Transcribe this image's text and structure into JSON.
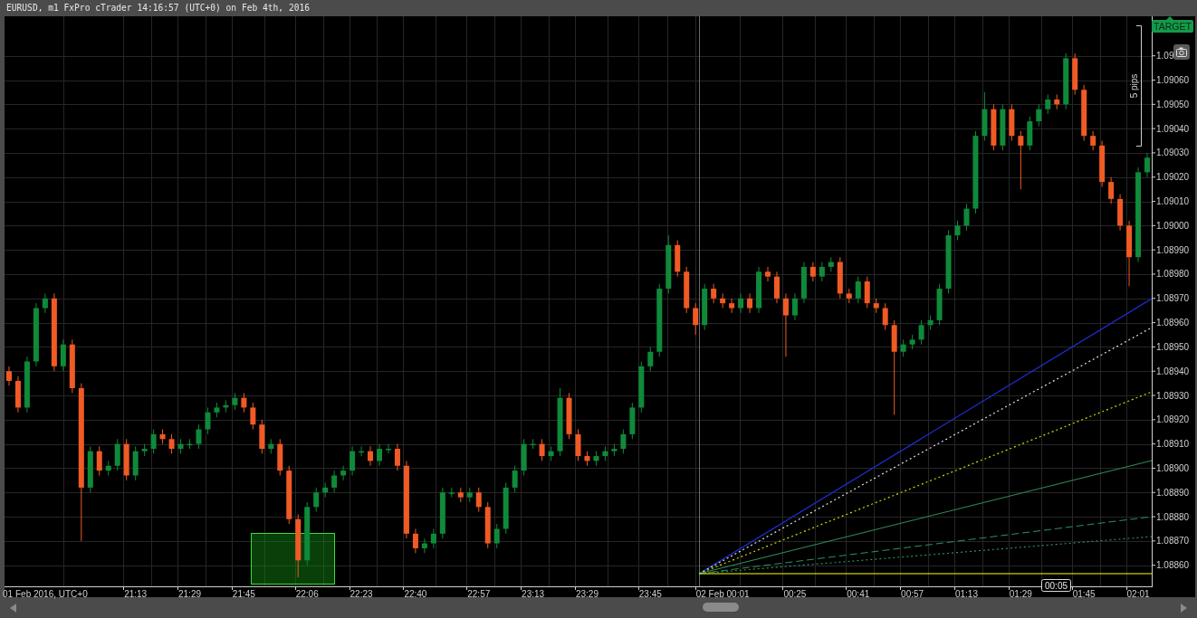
{
  "window": {
    "title": "EURUSD, m1 FxPro cTrader 14:16:57 (UTC+0) on Feb 4th, 2016"
  },
  "chart": {
    "target_label": "TARGET",
    "measure_label": "5 pips",
    "time_to_close": "00:05",
    "chart_data": {
      "type": "candlestick",
      "grid": true,
      "ylim": [
        1.088513,
        1.090863
      ],
      "categories": [
        null,
        null,
        null,
        null,
        "01 Feb 2016, UTC+0",
        null,
        null,
        null,
        null,
        null,
        null,
        null,
        null,
        null,
        "21:13",
        null,
        null,
        null,
        null,
        null,
        "21:29",
        null,
        null,
        null,
        null,
        null,
        "21:45",
        null,
        null,
        null,
        null,
        null,
        null,
        "22:06",
        null,
        null,
        null,
        null,
        null,
        "22:23",
        null,
        null,
        null,
        null,
        null,
        "22:40",
        null,
        null,
        null,
        null,
        null,
        null,
        "22:57",
        null,
        null,
        null,
        null,
        null,
        "23:13",
        null,
        null,
        null,
        null,
        null,
        "23:29",
        null,
        null,
        null,
        null,
        null,
        null,
        "23:45",
        null,
        null,
        null,
        null,
        null,
        null,
        null,
        "02 Feb 00:01",
        null,
        null,
        null,
        null,
        null,
        null,
        null,
        "00:25",
        null,
        null,
        null,
        null,
        null,
        null,
        "00:41",
        null,
        null,
        null,
        null,
        null,
        "00:57",
        null,
        null,
        null,
        null,
        null,
        "01:13",
        null,
        null,
        null,
        null,
        null,
        "01:29",
        null,
        null,
        null,
        null,
        null,
        null,
        "01:45",
        null,
        null,
        null,
        null,
        null,
        "02:01",
        null
      ],
      "yticks": [
        {
          "value": 1.0907,
          "label": "1.09"
        },
        {
          "value": 1.0906,
          "label": "1.09060"
        },
        {
          "value": 1.0905,
          "label": "1.09050"
        },
        {
          "value": 1.0904,
          "label": "1.09040"
        },
        {
          "value": 1.0903,
          "label": "1.09030"
        },
        {
          "value": 1.0902,
          "label": "1.09020"
        },
        {
          "value": 1.0901,
          "label": "1.09010"
        },
        {
          "value": 1.09,
          "label": "1.09000"
        },
        {
          "value": 1.0899,
          "label": "1.08990"
        },
        {
          "value": 1.0898,
          "label": "1.08980"
        },
        {
          "value": 1.0897,
          "label": "1.08970"
        },
        {
          "value": 1.0896,
          "label": "1.08960"
        },
        {
          "value": 1.0895,
          "label": "1.08950"
        },
        {
          "value": 1.0894,
          "label": "1.08940"
        },
        {
          "value": 1.0893,
          "label": "1.08930"
        },
        {
          "value": 1.0892,
          "label": "1.08920"
        },
        {
          "value": 1.0891,
          "label": "1.08910"
        },
        {
          "value": 1.089,
          "label": "1.08900"
        },
        {
          "value": 1.0889,
          "label": "1.08890"
        },
        {
          "value": 1.0888,
          "label": "1.08880"
        },
        {
          "value": 1.0887,
          "label": "1.08870"
        },
        {
          "value": 1.0886,
          "label": "1.08860"
        }
      ],
      "ohlc": [
        [
          1.0894,
          1.08942,
          1.08934,
          1.08936
        ],
        [
          1.08936,
          1.08938,
          1.08923,
          1.08925
        ],
        [
          1.08925,
          1.08946,
          1.08923,
          1.08944
        ],
        [
          1.08944,
          1.08968,
          1.08942,
          1.08966
        ],
        [
          1.08966,
          1.08972,
          1.08964,
          1.0897
        ],
        [
          1.0897,
          1.08972,
          1.0894,
          1.08942
        ],
        [
          1.08942,
          1.08953,
          1.0894,
          1.08951
        ],
        [
          1.08951,
          1.08953,
          1.08931,
          1.08933
        ],
        [
          1.08933,
          1.08935,
          1.0887,
          1.08892
        ],
        [
          1.08892,
          1.08909,
          1.0889,
          1.08907
        ],
        [
          1.08907,
          1.08909,
          1.08897,
          1.08899
        ],
        [
          1.08899,
          1.08903,
          1.08897,
          1.08901
        ],
        [
          1.08901,
          1.08912,
          1.08899,
          1.0891
        ],
        [
          1.0891,
          1.08912,
          1.08895,
          1.08897
        ],
        [
          1.08897,
          1.08909,
          1.08895,
          1.08907
        ],
        [
          1.08907,
          1.0891,
          1.08905,
          1.08908
        ],
        [
          1.08908,
          1.08916,
          1.08906,
          1.08914
        ],
        [
          1.08914,
          1.08916,
          1.0891,
          1.08912
        ],
        [
          1.08912,
          1.08914,
          1.08906,
          1.08908
        ],
        [
          1.08908,
          1.08912,
          1.08906,
          1.0891
        ],
        [
          1.0891,
          1.08912,
          1.08908,
          1.0891
        ],
        [
          1.0891,
          1.08918,
          1.08908,
          1.08916
        ],
        [
          1.08916,
          1.08925,
          1.08914,
          1.08923
        ],
        [
          1.08923,
          1.08927,
          1.08921,
          1.08925
        ],
        [
          1.08925,
          1.08928,
          1.08923,
          1.08926
        ],
        [
          1.08926,
          1.08931,
          1.08924,
          1.08929
        ],
        [
          1.08929,
          1.08931,
          1.08923,
          1.08925
        ],
        [
          1.08925,
          1.08927,
          1.08916,
          1.08918
        ],
        [
          1.08918,
          1.0892,
          1.08906,
          1.08908
        ],
        [
          1.08908,
          1.08912,
          1.08906,
          1.0891
        ],
        [
          1.0891,
          1.08912,
          1.08897,
          1.08899
        ],
        [
          1.08899,
          1.08901,
          1.08877,
          1.08879
        ],
        [
          1.08879,
          1.08881,
          1.08855,
          1.08862
        ],
        [
          1.08862,
          1.08886,
          1.0886,
          1.08884
        ],
        [
          1.08884,
          1.08892,
          1.08882,
          1.0889
        ],
        [
          1.0889,
          1.08894,
          1.08888,
          1.08892
        ],
        [
          1.08892,
          1.08899,
          1.0889,
          1.08897
        ],
        [
          1.08897,
          1.08901,
          1.08895,
          1.08899
        ],
        [
          1.08899,
          1.08909,
          1.08897,
          1.08907
        ],
        [
          1.08907,
          1.08909,
          1.08905,
          1.08907
        ],
        [
          1.08907,
          1.08909,
          1.08901,
          1.08903
        ],
        [
          1.08903,
          1.0891,
          1.08901,
          1.08908
        ],
        [
          1.08908,
          1.0891,
          1.08906,
          1.08908
        ],
        [
          1.08908,
          1.0891,
          1.08899,
          1.08901
        ],
        [
          1.08901,
          1.08903,
          1.08871,
          1.08873
        ],
        [
          1.08873,
          1.08875,
          1.08865,
          1.08867
        ],
        [
          1.08867,
          1.08871,
          1.08865,
          1.08869
        ],
        [
          1.08869,
          1.08875,
          1.08867,
          1.08873
        ],
        [
          1.08873,
          1.08892,
          1.08871,
          1.0889
        ],
        [
          1.0889,
          1.08892,
          1.08888,
          1.0889
        ],
        [
          1.0889,
          1.08892,
          1.08886,
          1.08888
        ],
        [
          1.08888,
          1.08892,
          1.08886,
          1.0889
        ],
        [
          1.0889,
          1.08892,
          1.08882,
          1.08884
        ],
        [
          1.08884,
          1.08886,
          1.08867,
          1.08869
        ],
        [
          1.08869,
          1.08877,
          1.08867,
          1.08875
        ],
        [
          1.08875,
          1.08894,
          1.08873,
          1.08892
        ],
        [
          1.08892,
          1.08901,
          1.0889,
          1.08899
        ],
        [
          1.08899,
          1.08912,
          1.08897,
          1.0891
        ],
        [
          1.0891,
          1.08912,
          1.08908,
          1.0891
        ],
        [
          1.0891,
          1.08912,
          1.08903,
          1.08905
        ],
        [
          1.08905,
          1.08909,
          1.08903,
          1.08907
        ],
        [
          1.08907,
          1.08933,
          1.08905,
          1.08929
        ],
        [
          1.08929,
          1.08931,
          1.08912,
          1.08914
        ],
        [
          1.08914,
          1.08916,
          1.08903,
          1.08905
        ],
        [
          1.08905,
          1.08907,
          1.08901,
          1.08903
        ],
        [
          1.08903,
          1.08907,
          1.08901,
          1.08905
        ],
        [
          1.08905,
          1.08909,
          1.08903,
          1.08907
        ],
        [
          1.08907,
          1.0891,
          1.08905,
          1.08908
        ],
        [
          1.08908,
          1.08916,
          1.08906,
          1.08914
        ],
        [
          1.08914,
          1.08927,
          1.08912,
          1.08925
        ],
        [
          1.08925,
          1.08944,
          1.08923,
          1.08942
        ],
        [
          1.08942,
          1.0895,
          1.0894,
          1.08948
        ],
        [
          1.08948,
          1.08976,
          1.08946,
          1.08974
        ],
        [
          1.08974,
          1.08996,
          1.08972,
          1.08992
        ],
        [
          1.08992,
          1.08994,
          1.08979,
          1.08981
        ],
        [
          1.08981,
          1.08983,
          1.08964,
          1.08966
        ],
        [
          1.08966,
          1.08968,
          1.08955,
          1.08959
        ],
        [
          1.08959,
          1.08976,
          1.08957,
          1.08974
        ],
        [
          1.08974,
          1.08976,
          1.08968,
          1.0897
        ],
        [
          1.0897,
          1.08972,
          1.08966,
          1.08968
        ],
        [
          1.08968,
          1.0897,
          1.08964,
          1.08966
        ],
        [
          1.08966,
          1.08972,
          1.08964,
          1.0897
        ],
        [
          1.0897,
          1.08972,
          1.08964,
          1.08966
        ],
        [
          1.08966,
          1.08983,
          1.08964,
          1.08981
        ],
        [
          1.08981,
          1.08983,
          1.08977,
          1.08979
        ],
        [
          1.08979,
          1.08981,
          1.08968,
          1.0897
        ],
        [
          1.0897,
          1.08972,
          1.08946,
          1.08963
        ],
        [
          1.08963,
          1.08972,
          1.08961,
          1.0897
        ],
        [
          1.0897,
          1.08985,
          1.08968,
          1.08983
        ],
        [
          1.08983,
          1.08985,
          1.08977,
          1.08979
        ],
        [
          1.08979,
          1.08985,
          1.08977,
          1.08983
        ],
        [
          1.08983,
          1.08987,
          1.08981,
          1.08985
        ],
        [
          1.08985,
          1.08987,
          1.0897,
          1.08972
        ],
        [
          1.08972,
          1.08974,
          1.08968,
          1.0897
        ],
        [
          1.0897,
          1.08979,
          1.08968,
          1.08977
        ],
        [
          1.08977,
          1.08979,
          1.08966,
          1.08968
        ],
        [
          1.08968,
          1.0897,
          1.08964,
          1.08966
        ],
        [
          1.08966,
          1.08968,
          1.08957,
          1.08959
        ],
        [
          1.08959,
          1.08961,
          1.08922,
          1.08948
        ],
        [
          1.08948,
          1.08953,
          1.08946,
          1.08951
        ],
        [
          1.08951,
          1.08955,
          1.08949,
          1.08953
        ],
        [
          1.08953,
          1.08961,
          1.08951,
          1.08959
        ],
        [
          1.08959,
          1.08963,
          1.08957,
          1.08961
        ],
        [
          1.08961,
          1.08976,
          1.08959,
          1.08974
        ],
        [
          1.08974,
          1.08998,
          1.08972,
          1.08996
        ],
        [
          1.08996,
          1.09002,
          1.08994,
          1.09
        ],
        [
          1.09,
          1.09009,
          1.08998,
          1.09007
        ],
        [
          1.09007,
          1.09039,
          1.09005,
          1.09037
        ],
        [
          1.09037,
          1.09055,
          1.09035,
          1.09048
        ],
        [
          1.09048,
          1.0905,
          1.09031,
          1.09033
        ],
        [
          1.09033,
          1.0905,
          1.09031,
          1.09048
        ],
        [
          1.09048,
          1.0905,
          1.09035,
          1.09037
        ],
        [
          1.09037,
          1.09039,
          1.09015,
          1.09033
        ],
        [
          1.09033,
          1.09045,
          1.09031,
          1.09043
        ],
        [
          1.09043,
          1.0905,
          1.09041,
          1.09048
        ],
        [
          1.09048,
          1.09054,
          1.09046,
          1.09052
        ],
        [
          1.09052,
          1.09054,
          1.09048,
          1.0905
        ],
        [
          1.0905,
          1.09071,
          1.09048,
          1.09069
        ],
        [
          1.09069,
          1.09071,
          1.09054,
          1.09056
        ],
        [
          1.09056,
          1.09058,
          1.09035,
          1.09037
        ],
        [
          1.09037,
          1.09039,
          1.09031,
          1.09033
        ],
        [
          1.09033,
          1.09035,
          1.09016,
          1.09018
        ],
        [
          1.09018,
          1.0902,
          1.09009,
          1.09011
        ],
        [
          1.09011,
          1.09013,
          1.08998,
          1.09
        ],
        [
          1.09,
          1.09002,
          1.08975,
          1.08987
        ],
        [
          1.08987,
          1.09024,
          1.08985,
          1.09022
        ],
        [
          1.09022,
          1.0903,
          1.0902,
          1.09028
        ]
      ]
    }
  }
}
